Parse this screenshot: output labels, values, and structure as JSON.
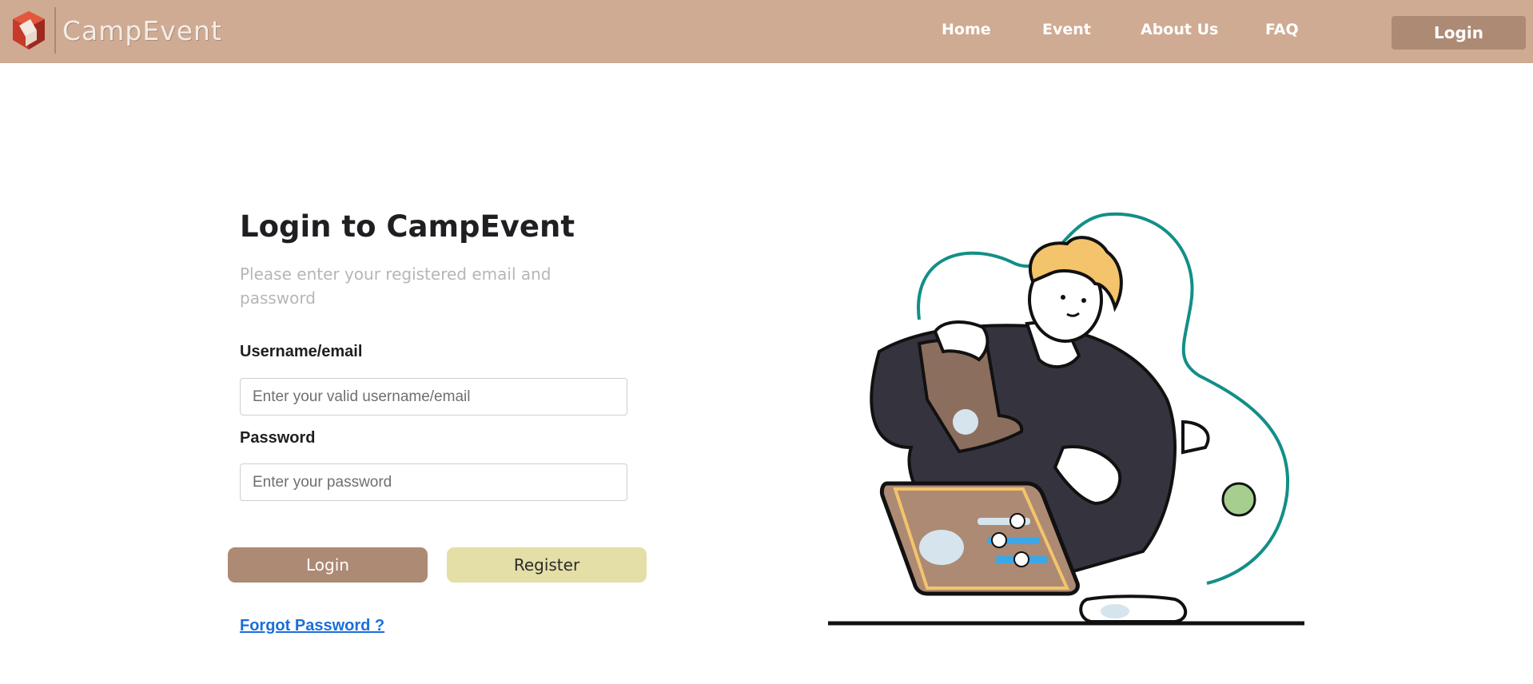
{
  "nav": {
    "brand": "CampEvent",
    "links": [
      {
        "label": "Home"
      },
      {
        "label": "Event"
      },
      {
        "label": "About Us"
      },
      {
        "label": "FAQ"
      }
    ],
    "login_label": "Login"
  },
  "login": {
    "title": "Login to CampEvent",
    "subtitle": "Please enter your registered email and password",
    "username_label": "Username/email",
    "username_placeholder": "Enter your valid username/email",
    "username_value": "",
    "password_label": "Password",
    "password_placeholder": "Enter your password",
    "password_value": "",
    "login_button": "Login",
    "register_button": "Register",
    "forgot_link": "Forgot Password ?"
  },
  "colors": {
    "navbar": "#cfab93",
    "primary_button": "#ad8a74",
    "register_button": "#e3dfa7",
    "link": "#1a6fd9",
    "illustration_outline": "#128f87"
  },
  "icons": {
    "brand_logo": "campevent-logo-icon"
  }
}
